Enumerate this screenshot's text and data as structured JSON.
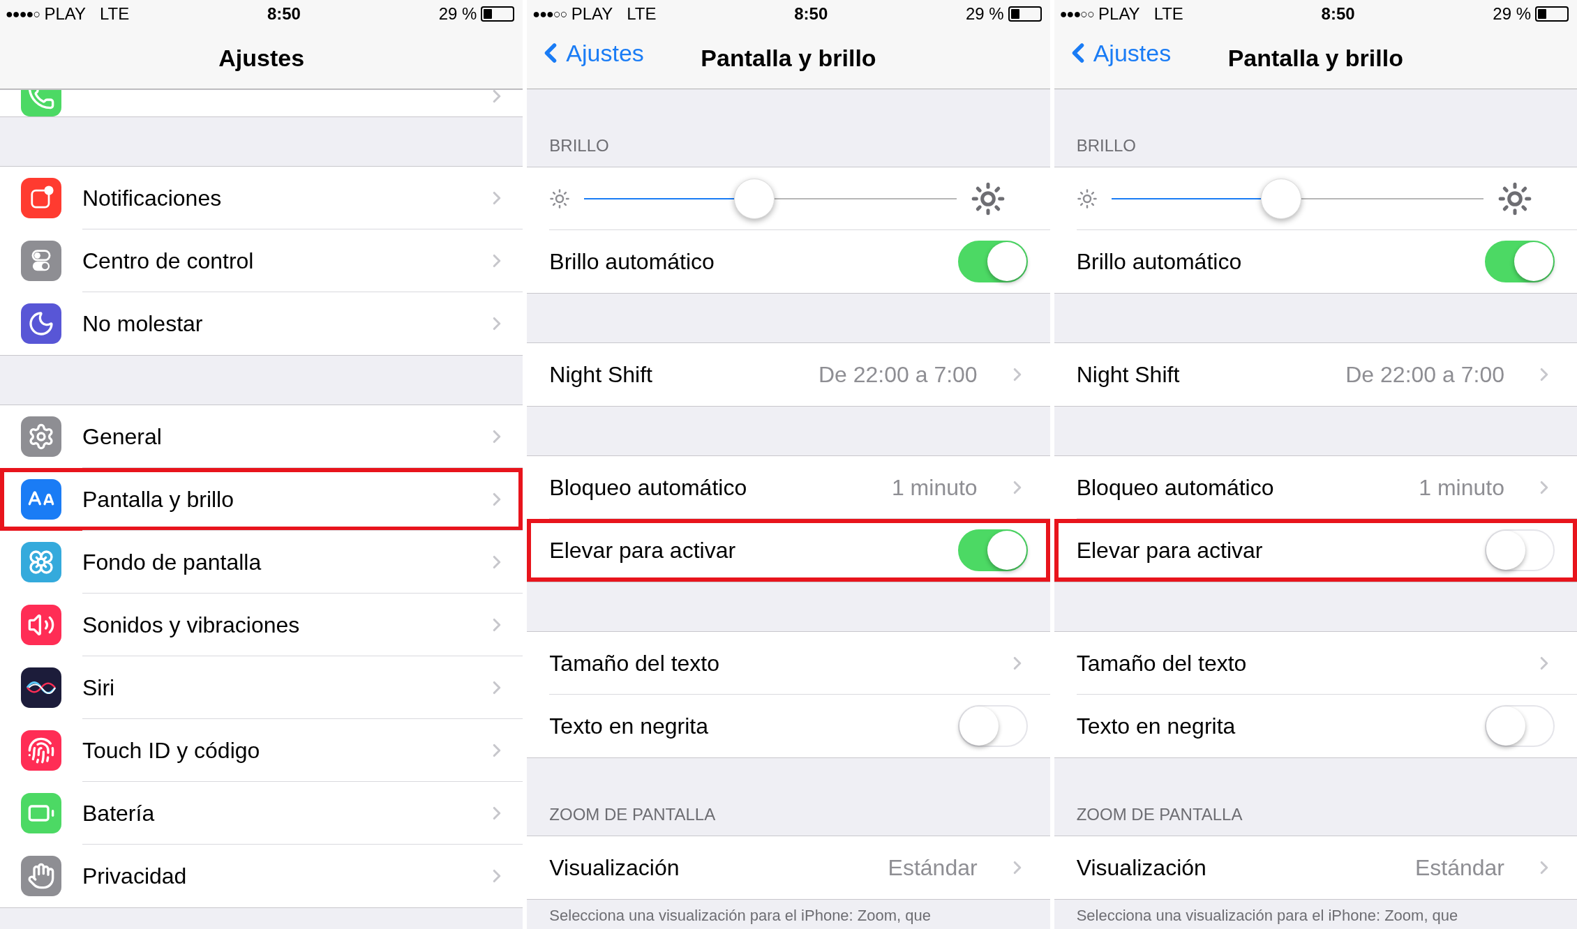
{
  "panels": [
    {
      "status": {
        "signal": "●●●●○",
        "carrier": "PLAY",
        "network": "LTE",
        "time": "8:50",
        "battery": "29 %"
      },
      "nav": {
        "title": "Ajustes"
      },
      "sections": [
        {
          "clipped": true,
          "items": [
            {
              "kind": "app-link",
              "highlighted": false
            }
          ]
        },
        {
          "items": [
            {
              "kind": "app-link",
              "label": "Notificaciones",
              "highlighted": false
            },
            {
              "kind": "app-link",
              "label": "Centro de control",
              "highlighted": false
            },
            {
              "kind": "app-link",
              "label": "No molestar",
              "highlighted": false
            }
          ]
        },
        {
          "items": [
            {
              "kind": "app-link",
              "label": "General",
              "highlighted": false
            },
            {
              "kind": "app-link",
              "label": "Pantalla y brillo",
              "highlighted": true
            },
            {
              "kind": "app-link",
              "label": "Fondo de pantalla",
              "highlighted": false
            },
            {
              "kind": "app-link",
              "label": "Sonidos y vibraciones",
              "highlighted": false
            },
            {
              "kind": "app-link",
              "label": "Siri",
              "highlighted": false
            },
            {
              "kind": "app-link",
              "label": "Touch ID y código",
              "highlighted": false
            },
            {
              "kind": "app-link",
              "label": "Batería",
              "highlighted": false
            },
            {
              "kind": "app-link",
              "label": "Privacidad",
              "highlighted": false
            }
          ]
        }
      ]
    },
    {
      "status": {
        "signal": "●●●○○",
        "carrier": "PLAY",
        "network": "LTE",
        "time": "8:50",
        "battery": "29 %"
      },
      "nav": {
        "back": "Ajustes",
        "title": "Pantalla y brillo"
      },
      "sections": [
        {
          "header": "BRILLO",
          "items": [
            {
              "kind": "slider",
              "level": 0.457,
              "highlighted": false
            },
            {
              "kind": "toggle",
              "label": "Brillo automático",
              "on": true,
              "highlighted": false
            }
          ]
        },
        {
          "items": [
            {
              "kind": "link",
              "label": "Night Shift",
              "value": "De 22:00 a 7:00",
              "highlighted": false
            }
          ]
        },
        {
          "items": [
            {
              "kind": "link",
              "label": "Bloqueo automático",
              "value": "1 minuto",
              "highlighted": false
            },
            {
              "kind": "toggle",
              "label": "Elevar para activar",
              "on": true,
              "highlighted": true
            }
          ]
        },
        {
          "items": [
            {
              "kind": "link",
              "label": "Tamaño del texto",
              "highlighted": false
            },
            {
              "kind": "toggle",
              "label": "Texto en negrita",
              "on": false,
              "highlighted": false
            }
          ]
        },
        {
          "header": "ZOOM DE PANTALLA",
          "footer": "Selecciona una visualización para el iPhone: Zoom, que",
          "items": [
            {
              "kind": "link",
              "label": "Visualización",
              "value": "Estándar",
              "highlighted": false
            }
          ]
        }
      ]
    },
    {
      "status": {
        "signal": "●●●○○",
        "carrier": "PLAY",
        "network": "LTE",
        "time": "8:50",
        "battery": "29 %"
      },
      "nav": {
        "back": "Ajustes",
        "title": "Pantalla y brillo"
      },
      "sections": [
        {
          "header": "BRILLO",
          "items": [
            {
              "kind": "slider",
              "level": 0.457,
              "highlighted": false
            },
            {
              "kind": "toggle",
              "label": "Brillo automático",
              "on": true,
              "highlighted": false
            }
          ]
        },
        {
          "items": [
            {
              "kind": "link",
              "label": "Night Shift",
              "value": "De 22:00 a 7:00",
              "highlighted": false
            }
          ]
        },
        {
          "items": [
            {
              "kind": "link",
              "label": "Bloqueo automático",
              "value": "1 minuto",
              "highlighted": false
            },
            {
              "kind": "toggle",
              "label": "Elevar para activar",
              "on": false,
              "highlighted": true
            }
          ]
        },
        {
          "items": [
            {
              "kind": "link",
              "label": "Tamaño del texto",
              "highlighted": false
            },
            {
              "kind": "toggle",
              "label": "Texto en negrita",
              "on": false,
              "highlighted": false
            }
          ]
        },
        {
          "header": "ZOOM DE PANTALLA",
          "footer": "Selecciona una visualización para el iPhone: Zoom, que",
          "items": [
            {
              "kind": "link",
              "label": "Visualización",
              "value": "Estándar",
              "highlighted": false
            }
          ]
        }
      ]
    }
  ]
}
